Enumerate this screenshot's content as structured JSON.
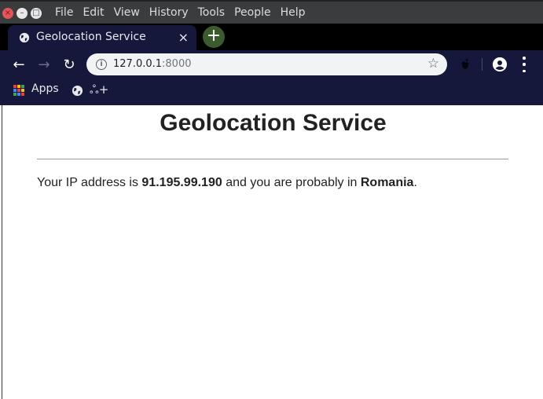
{
  "window": {
    "controls": {
      "close": "×",
      "minimize": "–",
      "maximize": "□"
    },
    "menu": [
      "File",
      "Edit",
      "View",
      "History",
      "Tools",
      "People",
      "Help"
    ]
  },
  "tabs": [
    {
      "title": "Geolocation Service",
      "icon": "globe-icon",
      "close": "×",
      "active": true
    }
  ],
  "new_tab": "+",
  "toolbar": {
    "back": "←",
    "forward": "→",
    "reload": "↻",
    "url_host": "127.0.0.1",
    "url_port": ":8000",
    "info": "i",
    "bookmark_star": "☆"
  },
  "bookmarks": {
    "apps_label": "Apps",
    "items": [
      {
        "icon": "globe-icon"
      },
      {
        "icon": "extension-add-icon",
        "label": "ஃ+"
      }
    ],
    "apps_colors": [
      "#e94235",
      "#fbbc04",
      "#34a853",
      "#4285f4",
      "#e94235",
      "#fbbc04",
      "#34a853",
      "#4285f4",
      "#e94235"
    ]
  },
  "page": {
    "title": "Geolocation Service",
    "msg_prefix": "Your IP address is ",
    "ip": "91.195.99.190",
    "msg_middle": " and you are probably in ",
    "country": "Romania",
    "msg_suffix": "."
  }
}
